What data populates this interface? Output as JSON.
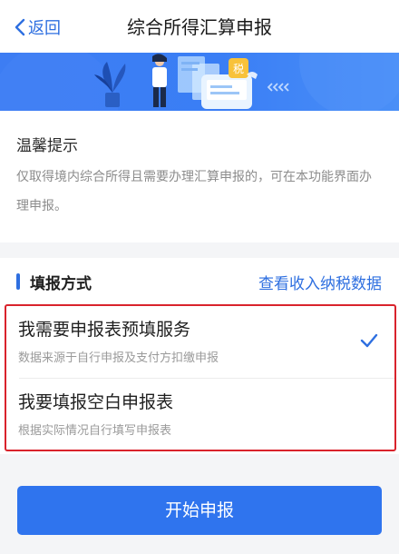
{
  "nav": {
    "back_label": "返回",
    "title": "综合所得汇算申报"
  },
  "banner": {
    "badge_text": "税"
  },
  "tips": {
    "title": "温馨提示",
    "body": "仅取得境内综合所得且需要办理汇算申报的，可在本功能界面办理申报。"
  },
  "method": {
    "title": "填报方式",
    "link_label": "查看收入纳税数据",
    "options": [
      {
        "title": "我需要申报表预填服务",
        "subtitle": "数据来源于自行申报及支付方扣缴申报",
        "selected": true
      },
      {
        "title": "我要填报空白申报表",
        "subtitle": "根据实际情况自行填写申报表",
        "selected": false
      }
    ]
  },
  "start_button": {
    "label": "开始申报"
  },
  "colors": {
    "accent": "#2e6fe0",
    "button": "#2f74ee",
    "highlight_border": "#d9232c"
  },
  "icons": [
    "back-chevron-icon",
    "checkmark-icon",
    "plant-icon",
    "person-icon",
    "tax-badge-icon"
  ]
}
